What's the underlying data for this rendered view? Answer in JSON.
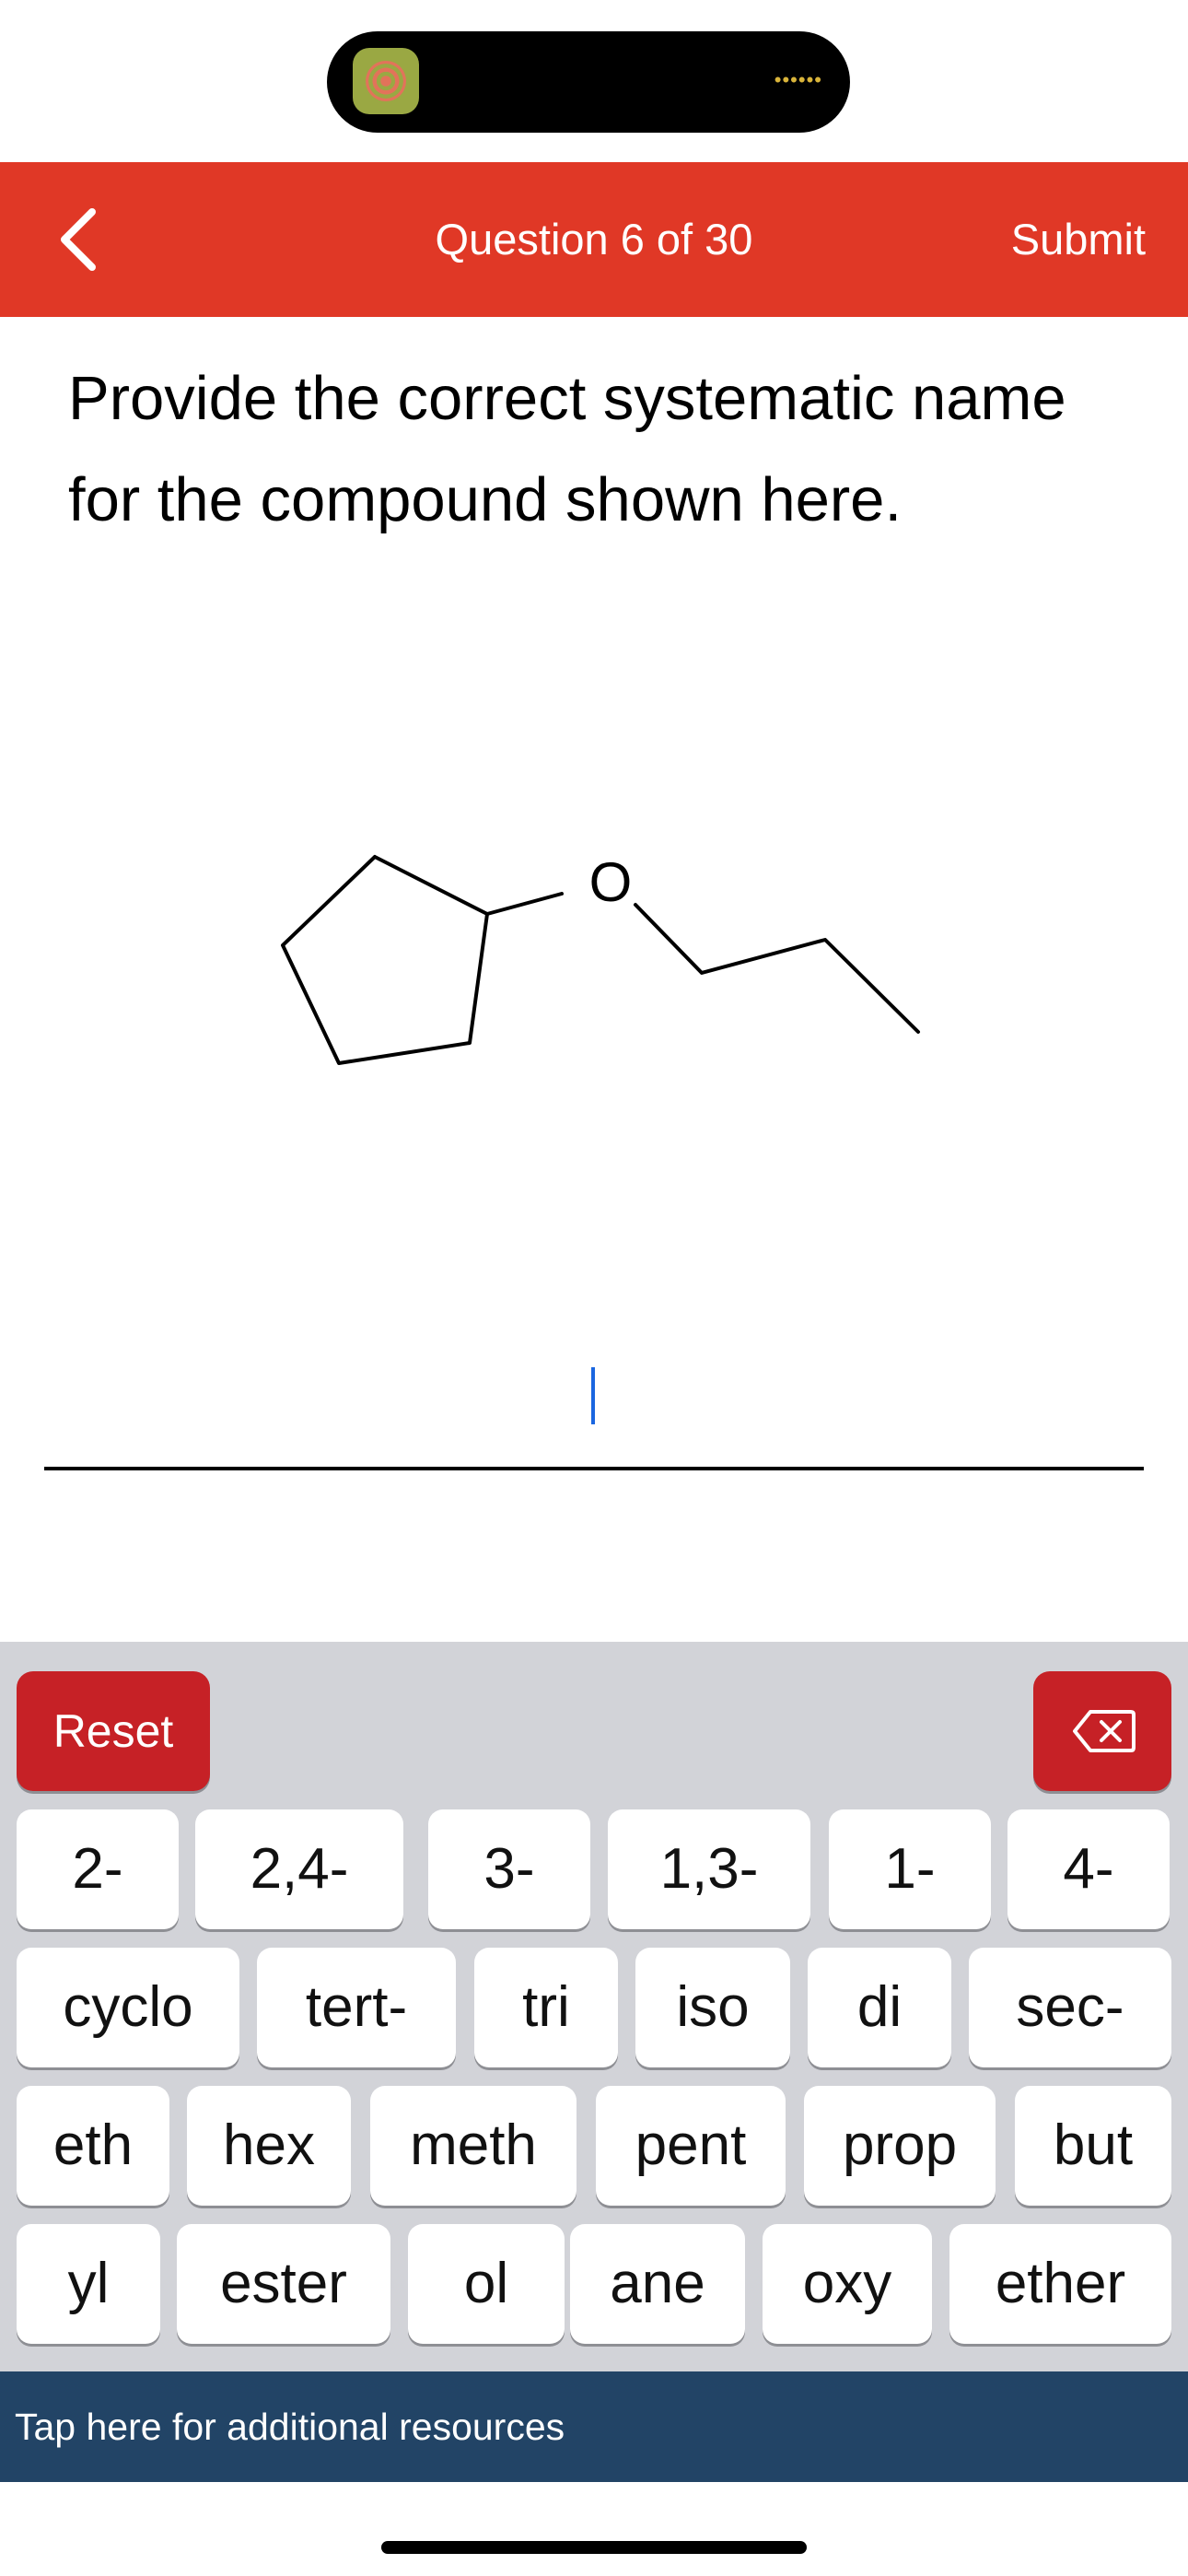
{
  "header": {
    "title": "Question 6 of 30",
    "submit_label": "Submit"
  },
  "question": {
    "text": "Provide the correct systematic name for the compound shown here."
  },
  "molecule": {
    "atom_label": "O"
  },
  "answer": {
    "value": ""
  },
  "keyboard": {
    "reset_label": "Reset",
    "rows": [
      [
        "2-",
        "2,4-",
        "3-",
        "1,3-",
        "1-",
        "4-"
      ],
      [
        "cyclo",
        "tert-",
        "tri",
        "iso",
        "di",
        "sec-"
      ],
      [
        "eth",
        "hex",
        "meth",
        "pent",
        "prop",
        "but"
      ],
      [
        "yl",
        "ester",
        "ol",
        "ane",
        "oxy",
        "ether"
      ]
    ]
  },
  "footer": {
    "resources_label": "Tap here for additional resources"
  },
  "colors": {
    "header_bar": "#e03826",
    "reset_button": "#c62126",
    "resources_bar": "#224466",
    "keyboard_bg": "#d2d3d8"
  }
}
